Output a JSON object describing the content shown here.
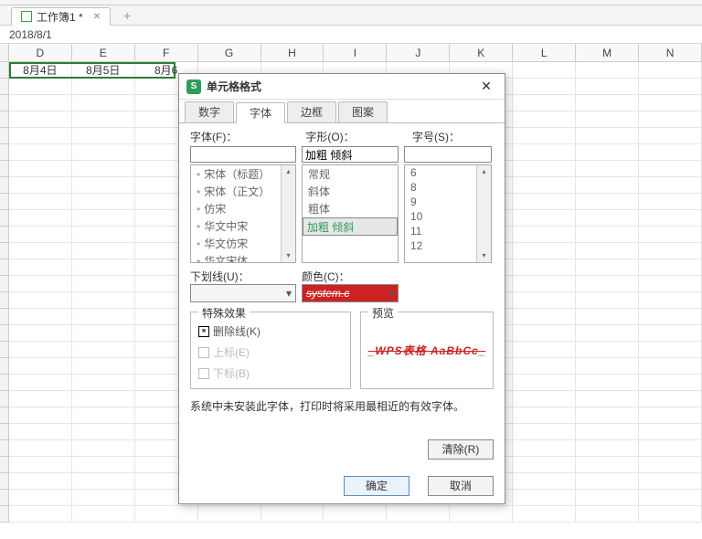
{
  "workbook": {
    "tab_name": "工作簿1 *",
    "add_label": "+"
  },
  "formula_bar": {
    "value": "2018/8/1"
  },
  "col_headers": [
    "D",
    "E",
    "F",
    "G",
    "H",
    "I",
    "J",
    "K",
    "L",
    "M",
    "N"
  ],
  "row1_cells": [
    "8月4日",
    "8月5日",
    "8月6",
    "",
    "",
    "",
    "",
    "",
    "",
    "",
    ""
  ],
  "dialog": {
    "title": "单元格格式",
    "tabs": [
      "数字",
      "字体",
      "边框",
      "图案"
    ],
    "active_tab": 1,
    "labels": {
      "font": "字体(F)：",
      "style": "字形(O)：",
      "size": "字号(S)：",
      "underline": "下划线(U)：",
      "color": "颜色(C)：",
      "effects": "特殊效果",
      "preview": "预览"
    },
    "font_input": "",
    "style_input": "加粗 倾斜",
    "size_input": "",
    "font_list": [
      "宋体（标题）",
      "宋体（正文）",
      "仿宋",
      "华文中宋",
      "华文仿宋",
      "华文宋体"
    ],
    "style_list": [
      "常规",
      "斜体",
      "粗体",
      "加粗 倾斜"
    ],
    "style_selected": "加粗 倾斜",
    "size_list": [
      "6",
      "8",
      "9",
      "10",
      "11",
      "12"
    ],
    "color_sample": "system.c",
    "effects": {
      "strike": "删除线(K)",
      "sup": "上标(E)",
      "sub": "下标(B)"
    },
    "preview_text": "_WPS表格  AaBbCc_",
    "note_text": "系统中未安装此字体，打印时将采用最相近的有效字体。",
    "buttons": {
      "clear": "清除(R)",
      "ok": "确定",
      "cancel": "取消"
    }
  }
}
